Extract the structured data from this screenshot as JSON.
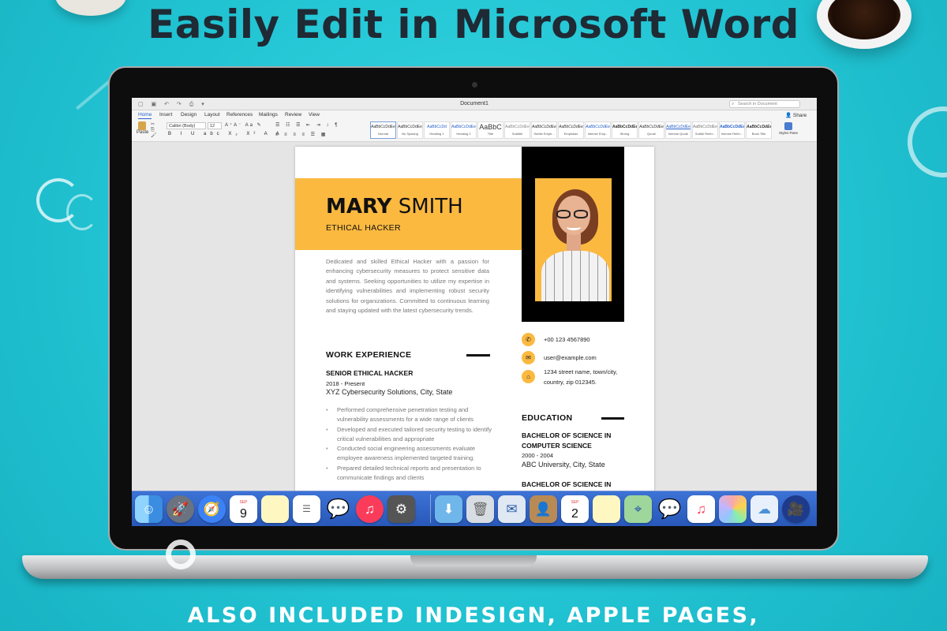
{
  "headline": "Easily Edit in Microsoft Word",
  "footer": "ALSO INCLUDED INDESIGN, APPLE PAGES,",
  "word": {
    "window_title": "Document1",
    "search_placeholder": "Search in Document",
    "share_label": "Share",
    "tabs": [
      {
        "label": "Home",
        "active": true
      },
      {
        "label": "Insert"
      },
      {
        "label": "Design"
      },
      {
        "label": "Layout"
      },
      {
        "label": "References"
      },
      {
        "label": "Mailings"
      },
      {
        "label": "Review"
      },
      {
        "label": "View"
      }
    ],
    "paste_label": "Paste",
    "font_name": "Calibri (Body)",
    "font_size": "12",
    "styles": [
      {
        "sample": "AaBbCcDdEe",
        "name": "Normal"
      },
      {
        "sample": "AaBbCcDdEe",
        "name": "No Spacing"
      },
      {
        "sample": "AaBbCcDd",
        "name": "Heading 1"
      },
      {
        "sample": "AaBbCcDdEe",
        "name": "Heading 2"
      },
      {
        "sample": "AaBbC",
        "name": "Title"
      },
      {
        "sample": "AaBbCcDdEe",
        "name": "Subtitle"
      },
      {
        "sample": "AaBbCcDdEe",
        "name": "Subtle Emph..."
      },
      {
        "sample": "AaBbCcDdEe",
        "name": "Emphasis"
      },
      {
        "sample": "AaBbCcDdEe",
        "name": "Intense Emp..."
      },
      {
        "sample": "AaBbCcDdEe",
        "name": "Strong"
      },
      {
        "sample": "AaBbCcDdEe",
        "name": "Quote"
      },
      {
        "sample": "AaBbCcDdEe",
        "name": "Intense Quote"
      },
      {
        "sample": "AaBbCcDdEe",
        "name": "Subtle Refer..."
      },
      {
        "sample": "AaBbCcDdEe",
        "name": "Intense Refer..."
      },
      {
        "sample": "AaBbCcDdEe",
        "name": "Book Title"
      }
    ],
    "styles_pane_label": "Styles Pane"
  },
  "resume": {
    "first_name": "MARY",
    "last_name": "SMITH",
    "role": "ETHICAL HACKER",
    "summary": "Dedicated and skilled Ethical Hacker with a passion for enhancing cybersecurity measures to protect sensitive data and systems. Seeking opportunities to utilize my expertise in identifying vulnerabilities and implementing robust security solutions for organizations. Committed to continuous learning and staying updated with the latest cybersecurity trends.",
    "work_heading": "WORK EXPERIENCE",
    "job": {
      "title": "SENIOR ETHICAL HACKER",
      "dates": "2018 - Present",
      "company": "XYZ Cybersecurity Solutions, City, State",
      "bullets": [
        "Performed comprehensive penetration testing and vulnerability assessments for a wide range of clients",
        "Developed and executed tailored security testing to identify critical vulnerabilities and appropriate",
        "Conducted social engineering assessments evaluate employee awareness implemented targeted training.",
        "Prepared detailed technical reports and presentation to communicate findings and clients"
      ]
    },
    "contact": {
      "phone": "+00 123 4567890",
      "email": "user@example.com",
      "address_line1": "1234 street name, town/city,",
      "address_line2": "country, zip 012345."
    },
    "education_heading": "EDUCATION",
    "education": [
      {
        "degree": "BACHELOR OF SCIENCE IN COMPUTER SCIENCE",
        "dates": "2000 - 2004",
        "school": "ABC University, City, State"
      },
      {
        "degree": "BACHELOR OF SCIENCE IN"
      }
    ]
  },
  "dock": {
    "calendar_month": "SEP",
    "calendar_day": "9",
    "calendar_day2": "2",
    "icons": [
      "finder-icon",
      "launchpad-icon",
      "safari-icon",
      "calendar-icon",
      "notes-icon",
      "reminders-icon",
      "messages-icon",
      "itunes-icon",
      "system-preferences-icon",
      "downloads-folder-icon",
      "trash-icon",
      "mail-icon",
      "contacts-icon",
      "calendar-icon",
      "notes-icon",
      "maps-icon",
      "messages-icon",
      "music-icon",
      "photos-icon",
      "icloud-icon",
      "photo-booth-icon"
    ]
  },
  "colors": {
    "background": "#22c4d3",
    "accent": "#fbb940",
    "dock": "#2f63c4"
  }
}
